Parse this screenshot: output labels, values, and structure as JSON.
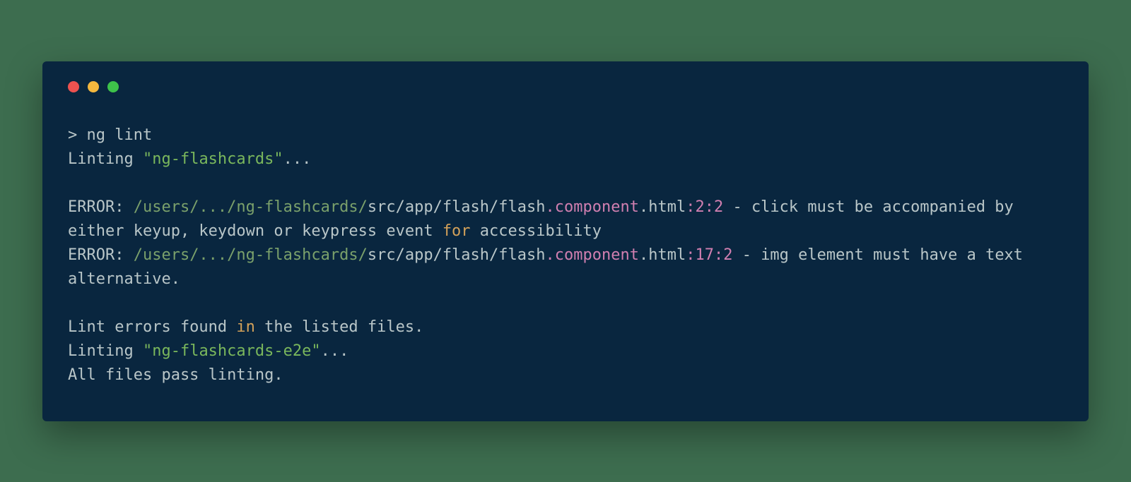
{
  "titlebar": {
    "close": "close",
    "min": "minimize",
    "zoom": "zoom"
  },
  "colors": {
    "terminal_bg": "#09263f",
    "page_bg": "#3d6d4f",
    "default_text": "#b9c6c8",
    "path_text": "#7aa06b",
    "project_text": "#7ab75c",
    "accent_text": "#d07fb0",
    "keyword_text": "#d3a15a"
  },
  "lines": [
    {
      "segments": [
        {
          "style": "c-default",
          "text": "> ng lint"
        }
      ]
    },
    {
      "segments": [
        {
          "style": "c-default",
          "text": "Linting "
        },
        {
          "style": "c-project",
          "text": "\"ng-flashcards\""
        },
        {
          "style": "c-default",
          "text": "..."
        }
      ]
    },
    {
      "blank": true
    },
    {
      "segments": [
        {
          "style": "c-default",
          "text": "ERROR: "
        },
        {
          "style": "c-path",
          "text": "/users/.../ng-flashcards/"
        },
        {
          "style": "c-default",
          "text": "src/app/flash/flash"
        },
        {
          "style": "c-accent",
          "text": ".component"
        },
        {
          "style": "c-default",
          "text": ".html"
        },
        {
          "style": "c-accent",
          "text": ":2:2"
        },
        {
          "style": "c-default",
          "text": " - click must be accompanied by either keyup, keydown or keypress event "
        },
        {
          "style": "c-keyword",
          "text": "for"
        },
        {
          "style": "c-default",
          "text": " accessibility"
        }
      ]
    },
    {
      "segments": [
        {
          "style": "c-default",
          "text": "ERROR: "
        },
        {
          "style": "c-path",
          "text": "/users/.../ng-flashcards/"
        },
        {
          "style": "c-default",
          "text": "src/app/flash/flash"
        },
        {
          "style": "c-accent",
          "text": ".component"
        },
        {
          "style": "c-default",
          "text": ".html"
        },
        {
          "style": "c-accent",
          "text": ":17:2"
        },
        {
          "style": "c-default",
          "text": " - img element must have a text alternative."
        }
      ]
    },
    {
      "blank": true
    },
    {
      "segments": [
        {
          "style": "c-default",
          "text": "Lint errors found "
        },
        {
          "style": "c-keyword",
          "text": "in"
        },
        {
          "style": "c-default",
          "text": " the listed files."
        }
      ]
    },
    {
      "segments": [
        {
          "style": "c-default",
          "text": "Linting "
        },
        {
          "style": "c-project",
          "text": "\"ng-flashcards-e2e\""
        },
        {
          "style": "c-default",
          "text": "..."
        }
      ]
    },
    {
      "segments": [
        {
          "style": "c-default",
          "text": "All files pass linting."
        }
      ]
    }
  ]
}
